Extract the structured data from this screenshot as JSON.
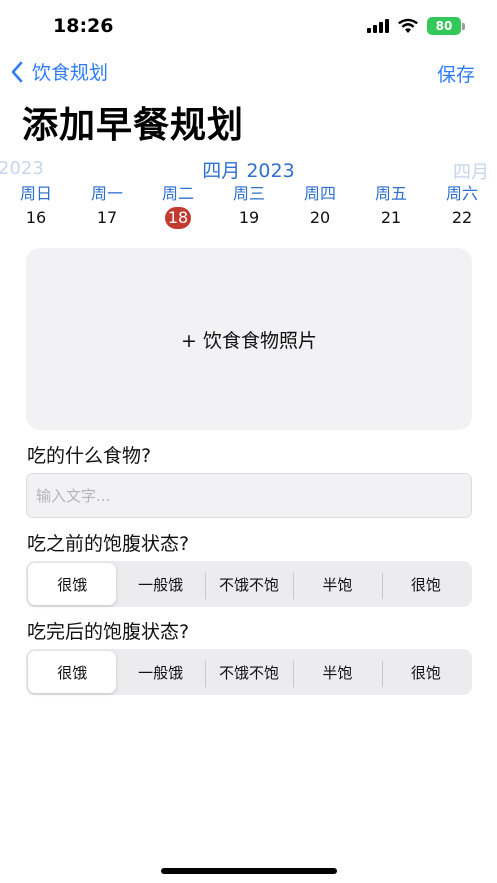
{
  "status_bar": {
    "time": "18:26",
    "battery": "80",
    "icons": [
      "signal-icon",
      "wifi-icon",
      "battery-icon"
    ]
  },
  "nav": {
    "back_label": "饮食规划",
    "save_label": "保存"
  },
  "title": "添加早餐规划",
  "calendar": {
    "month_prev": "2023",
    "month_current": "四月 2023",
    "month_next": "四月",
    "days": [
      {
        "weekday": "周日",
        "date": "16"
      },
      {
        "weekday": "周一",
        "date": "17"
      },
      {
        "weekday": "周二",
        "date": "18"
      },
      {
        "weekday": "周三",
        "date": "19"
      },
      {
        "weekday": "周四",
        "date": "20"
      },
      {
        "weekday": "周五",
        "date": "21"
      },
      {
        "weekday": "周六",
        "date": "22"
      }
    ],
    "selected_date": "18",
    "accent_color": "#2f6fd0",
    "selected_color": "#c23b30"
  },
  "photo": {
    "label": "+ 饮食食物照片"
  },
  "food": {
    "label": "吃的什么食物?",
    "placeholder": "输入文字...",
    "value": ""
  },
  "before": {
    "label": "吃之前的饱腹状态?",
    "options": [
      "很饿",
      "一般饿",
      "不饿不饱",
      "半饱",
      "很饱"
    ],
    "selected": "很饿"
  },
  "after": {
    "label": "吃完后的饱腹状态?",
    "options": [
      "很饿",
      "一般饿",
      "不饿不饱",
      "半饱",
      "很饱"
    ],
    "selected": "很饿"
  },
  "colors": {
    "link": "#2f7df6",
    "battery": "#34c759"
  }
}
